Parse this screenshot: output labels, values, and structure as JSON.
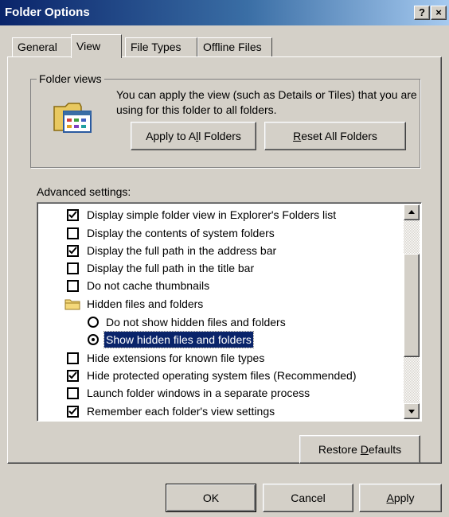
{
  "window": {
    "title": "Folder Options",
    "help_glyph": "?",
    "close_glyph": "×"
  },
  "tabs": [
    {
      "label": "General",
      "active": false
    },
    {
      "label": "View",
      "active": true
    },
    {
      "label": "File Types",
      "active": false
    },
    {
      "label": "Offline Files",
      "active": false
    }
  ],
  "folder_views": {
    "group_label": "Folder views",
    "description": "You can apply the view (such as Details or Tiles) that you are using for this folder to all folders.",
    "apply_all": {
      "pre": "Apply to A",
      "key": "l",
      "post": "l Folders"
    },
    "reset_all": {
      "pre": "",
      "key": "R",
      "post": "eset All Folders"
    }
  },
  "advanced": {
    "label": "Advanced settings:",
    "items": [
      {
        "type": "checkbox",
        "checked": true,
        "label": "Display simple folder view in Explorer's Folders list"
      },
      {
        "type": "checkbox",
        "checked": false,
        "label": "Display the contents of system folders"
      },
      {
        "type": "checkbox",
        "checked": true,
        "label": "Display the full path in the address bar"
      },
      {
        "type": "checkbox",
        "checked": false,
        "label": "Display the full path in the title bar"
      },
      {
        "type": "checkbox",
        "checked": false,
        "label": "Do not cache thumbnails"
      },
      {
        "type": "folder",
        "label": "Hidden files and folders"
      },
      {
        "type": "radio",
        "checked": false,
        "label": "Do not show hidden files and folders"
      },
      {
        "type": "radio",
        "checked": true,
        "selected": true,
        "label": "Show hidden files and folders"
      },
      {
        "type": "checkbox",
        "checked": false,
        "label": "Hide extensions for known file types"
      },
      {
        "type": "checkbox",
        "checked": true,
        "label": "Hide protected operating system files (Recommended)"
      },
      {
        "type": "checkbox",
        "checked": false,
        "label": "Launch folder windows in a separate process"
      },
      {
        "type": "checkbox",
        "checked": true,
        "label": "Remember each folder's view settings"
      }
    ]
  },
  "restore_defaults": {
    "pre": "Restore ",
    "key": "D",
    "post": "efaults"
  },
  "footer": {
    "ok": "OK",
    "cancel": "Cancel",
    "apply": {
      "pre": "",
      "key": "A",
      "post": "pply"
    }
  },
  "colors": {
    "face": "#d4d0c8",
    "title_start": "#0a246a",
    "title_end": "#a6caf0",
    "selection": "#0a246a"
  },
  "icons": {
    "folder_views": "folder-with-window-icon",
    "tree_folder": "folder-icon",
    "scroll_up": "arrow-up-icon",
    "scroll_down": "arrow-down-icon"
  }
}
